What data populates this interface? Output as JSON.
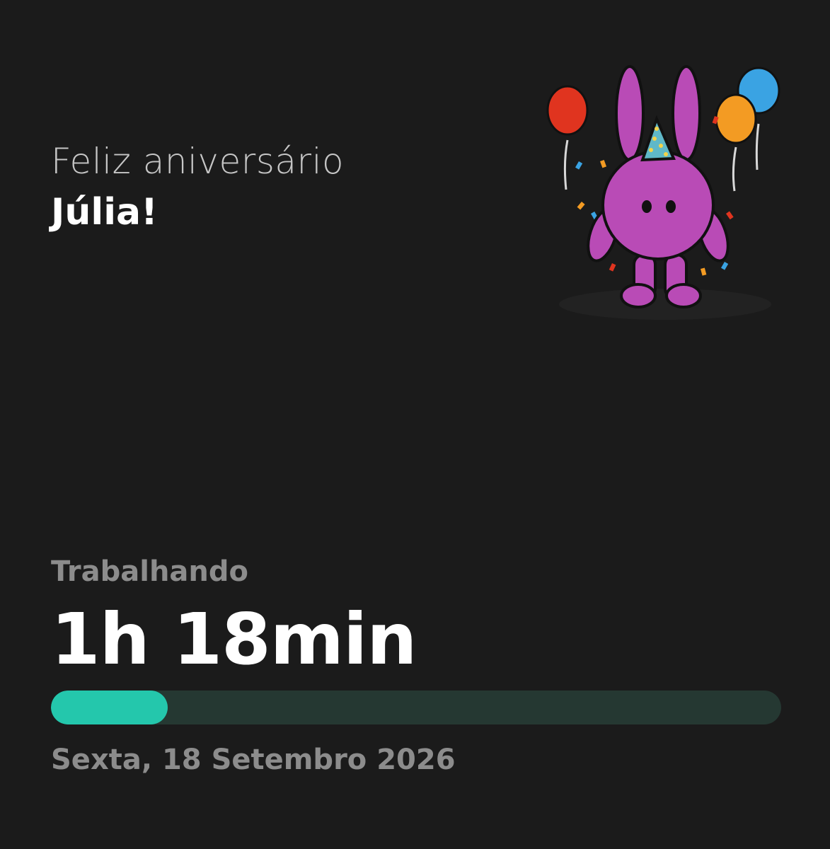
{
  "greeting": {
    "line1": "Feliz aniversário",
    "name": "Júlia!"
  },
  "illustration": {
    "icon": "birthday-bunny-with-balloons",
    "colors": {
      "bunny": "#b94bb6",
      "balloon_red": "#e0341f",
      "balloon_orange": "#f39b23",
      "balloon_blue": "#3aa3e3",
      "party_hat": "#5fb8c8"
    }
  },
  "work_status": {
    "label": "Trabalhando",
    "duration": "1h 18min",
    "progress": 0.16,
    "date": "Sexta, 18 Setembro 2026"
  },
  "colors": {
    "background": "#1b1b1b",
    "accent": "#24c7ac",
    "track": "#253832"
  }
}
